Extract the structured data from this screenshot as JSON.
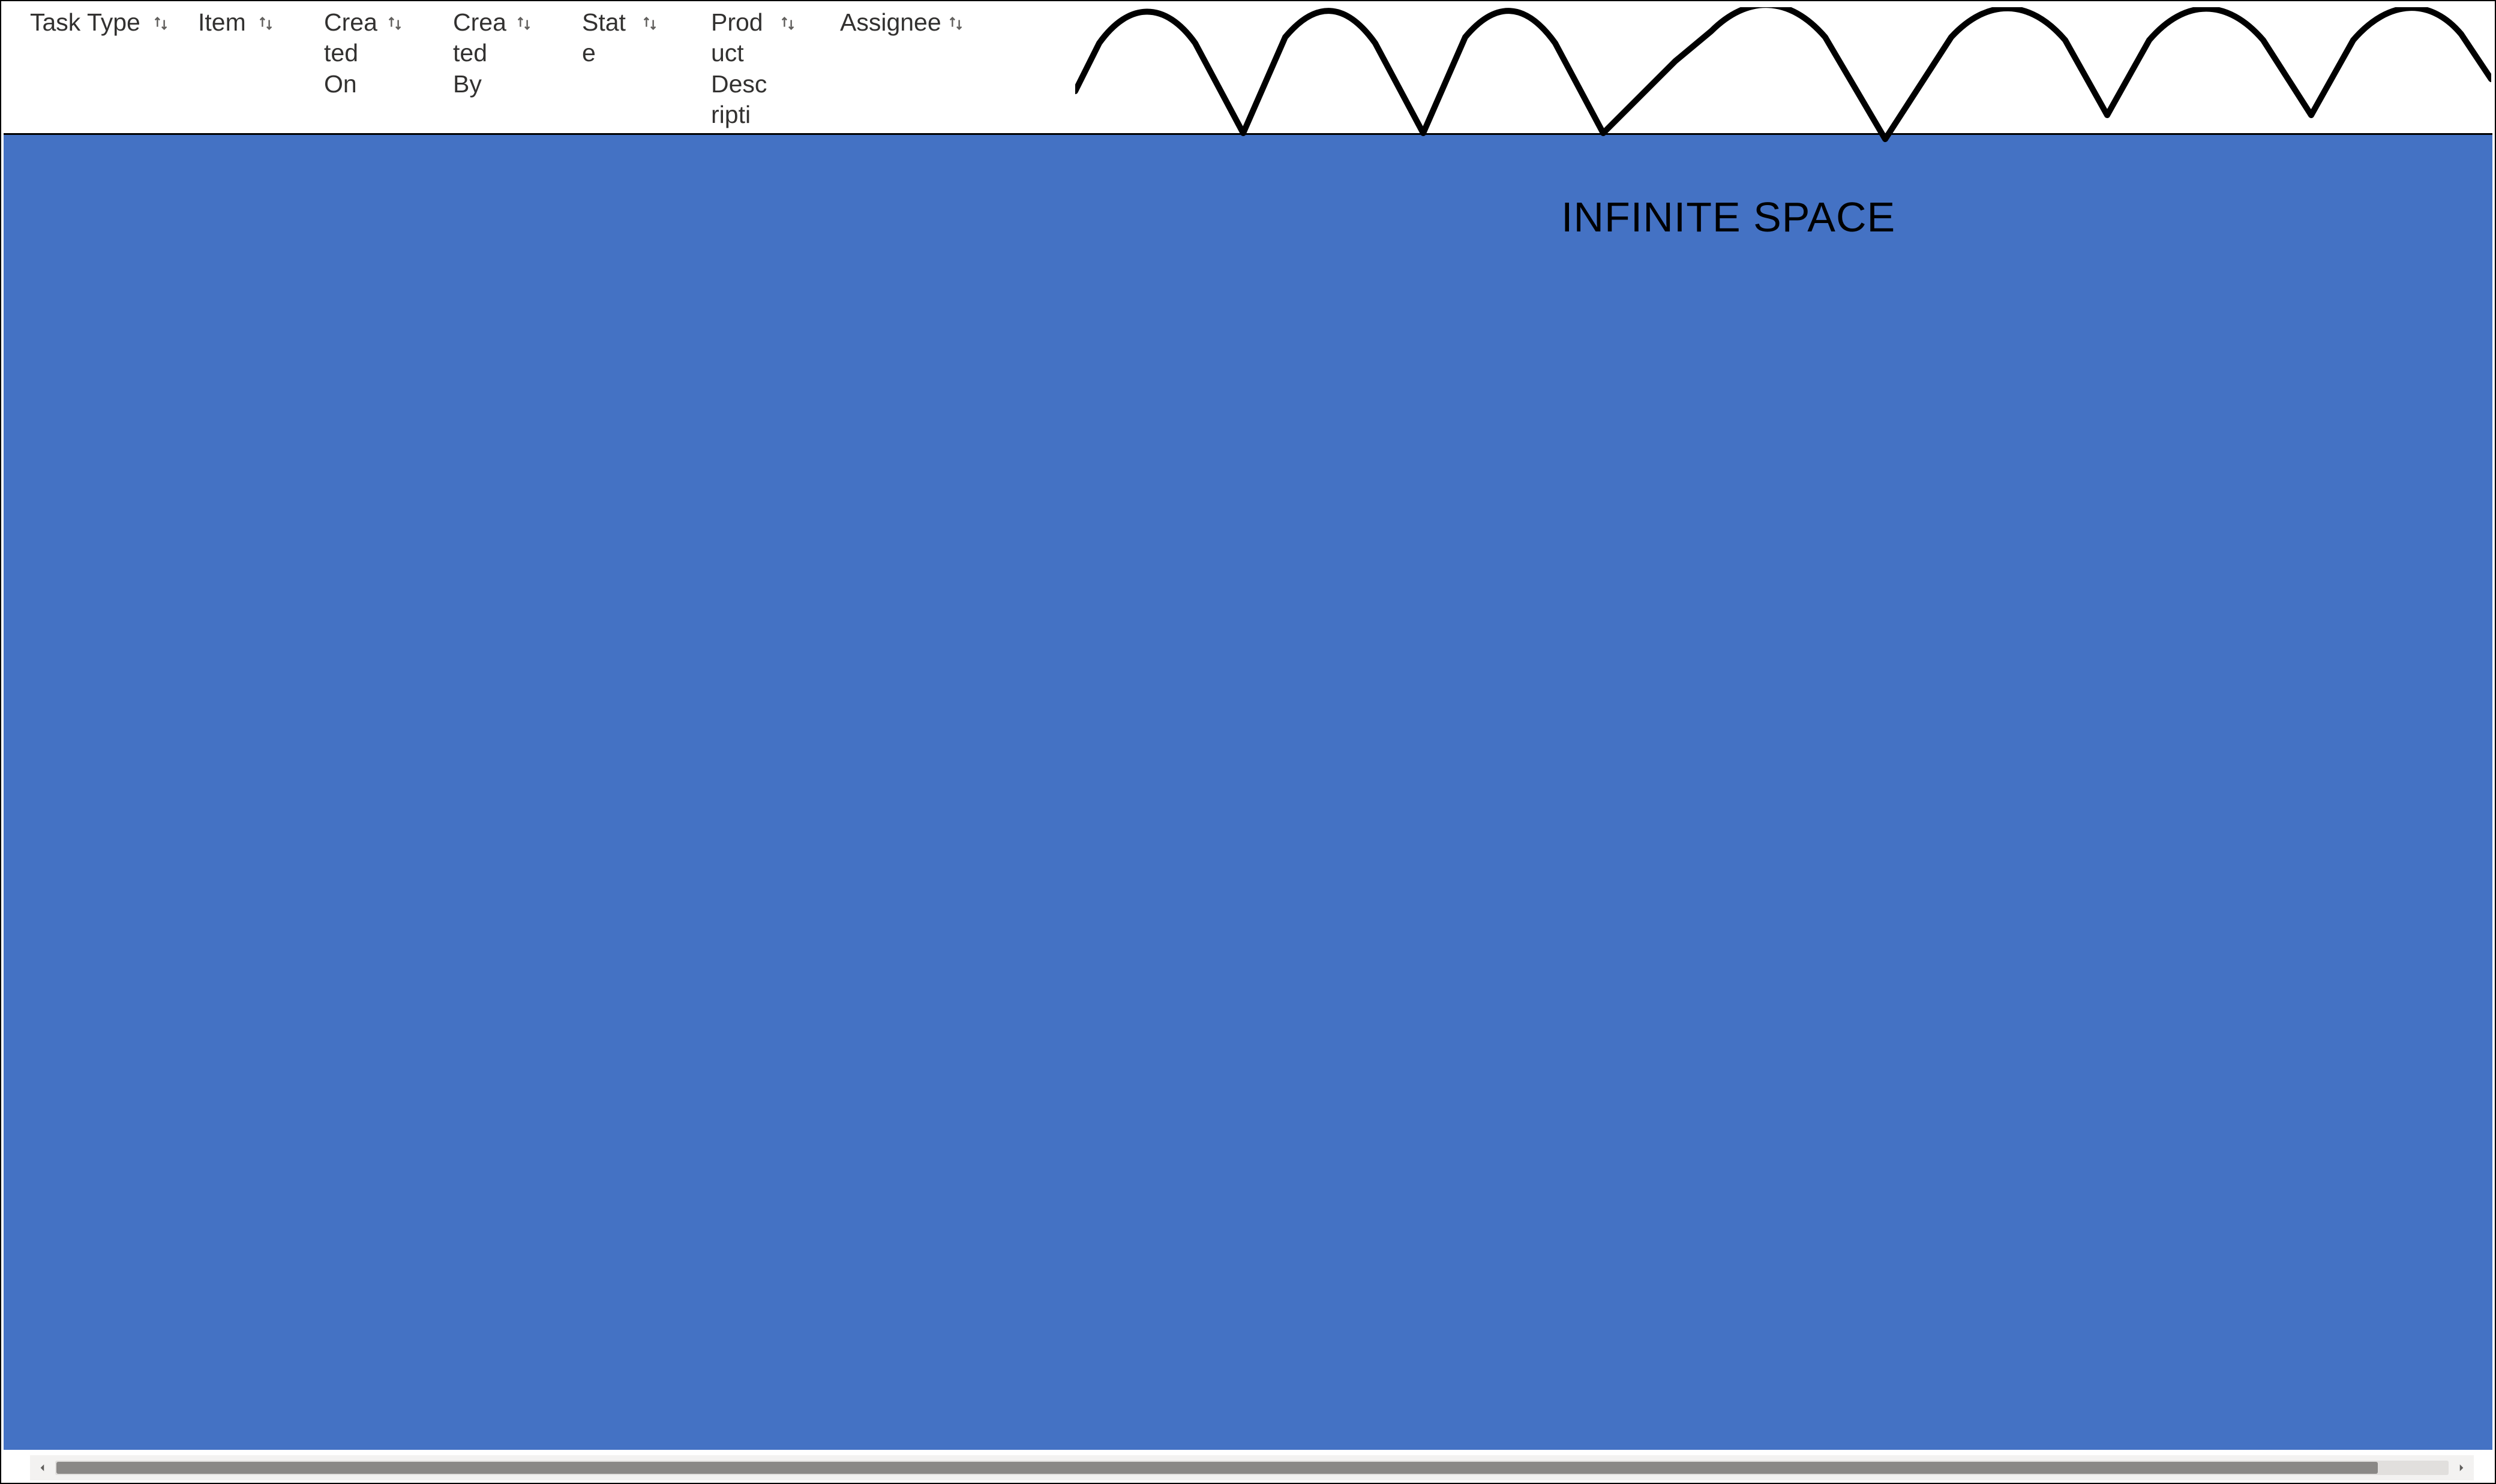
{
  "table": {
    "columns": [
      {
        "key": "task_type",
        "label": "Task Type",
        "sortable": true
      },
      {
        "key": "item",
        "label": "Item",
        "sortable": true
      },
      {
        "key": "created_on",
        "label": "Created On",
        "sortable": true
      },
      {
        "key": "created_by",
        "label": "Created By",
        "sortable": true
      },
      {
        "key": "state",
        "label": "State",
        "sortable": true
      },
      {
        "key": "product_description",
        "label": "Product Descripti",
        "sortable": true
      },
      {
        "key": "assignee",
        "label": "Assignee",
        "sortable": true
      }
    ]
  },
  "annotation": {
    "label": "INFINITE SPACE"
  },
  "colors": {
    "overlay_fill": "#4472c4",
    "annotation_stroke": "#000000"
  }
}
